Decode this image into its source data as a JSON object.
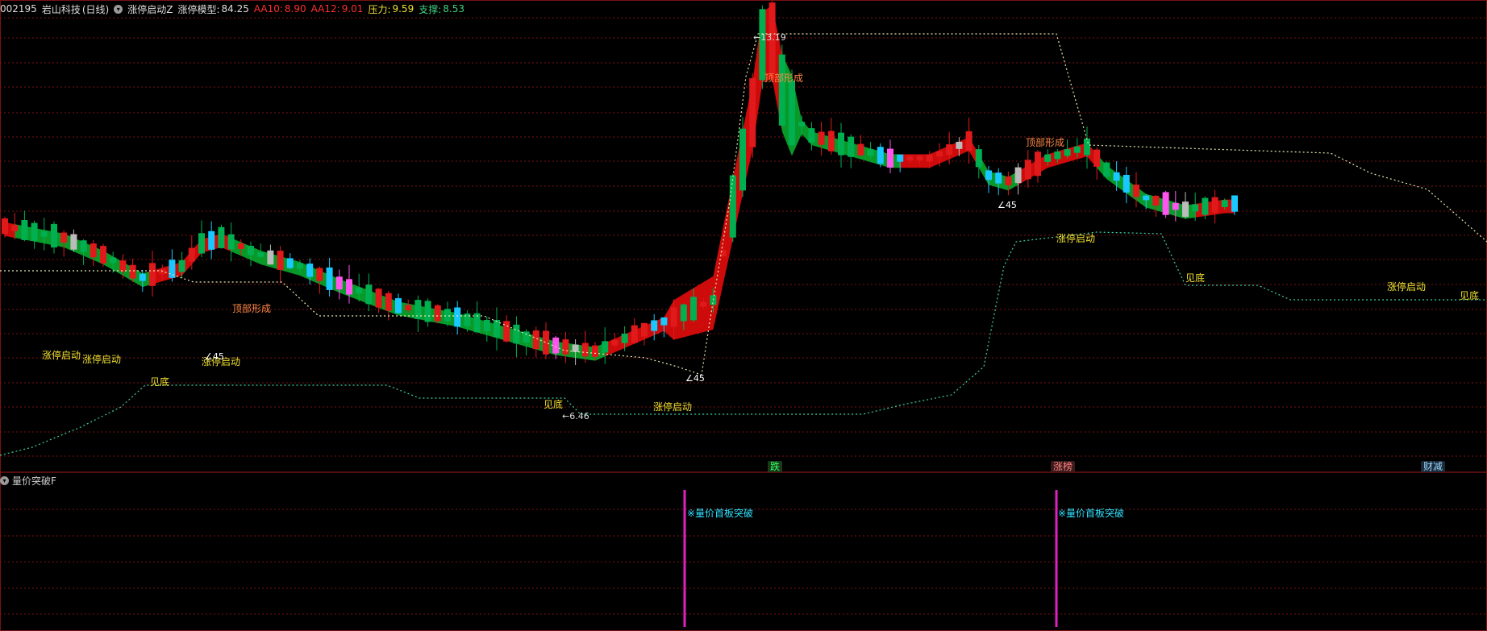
{
  "header": {
    "code": "002195",
    "name": "岩山科技",
    "period": "(日线)",
    "indicator": "涨停启动Z",
    "model_label": "涨停模型:",
    "model_value": "84.25",
    "aa10_label": "AA10:",
    "aa10_value": "8.90",
    "aa12_label": "AA12:",
    "aa12_value": "9.01",
    "pressure_label": "压力:",
    "pressure_value": "9.59",
    "support_label": "支撑:",
    "support_value": "8.53"
  },
  "sub_panel": {
    "title": "量价突破F",
    "signal_label": "※量价首板突破"
  },
  "event_tags": [
    "跌",
    "涨榜",
    "财减"
  ],
  "annotations": {
    "top": "顶部形成",
    "start": "涨停启动",
    "bottom": "见底",
    "angle": "∠45",
    "high": "13.19",
    "low": "6.46"
  },
  "colors": {
    "up": "#e0191b",
    "down": "#00b050",
    "cyan": "#18c8ff",
    "magenta": "#ff55ee",
    "label_yellow": "#f0e030",
    "label_orange": "#ff8844",
    "grid": "#7a1212",
    "signal": "#e020c0",
    "dotted_upper": "#e8e8b0",
    "dotted_lower": "#40d0a0"
  },
  "chart_data": {
    "type": "candlestick",
    "max_price": "13.19",
    "min_price": "6.46",
    "signal_count": 2
  }
}
